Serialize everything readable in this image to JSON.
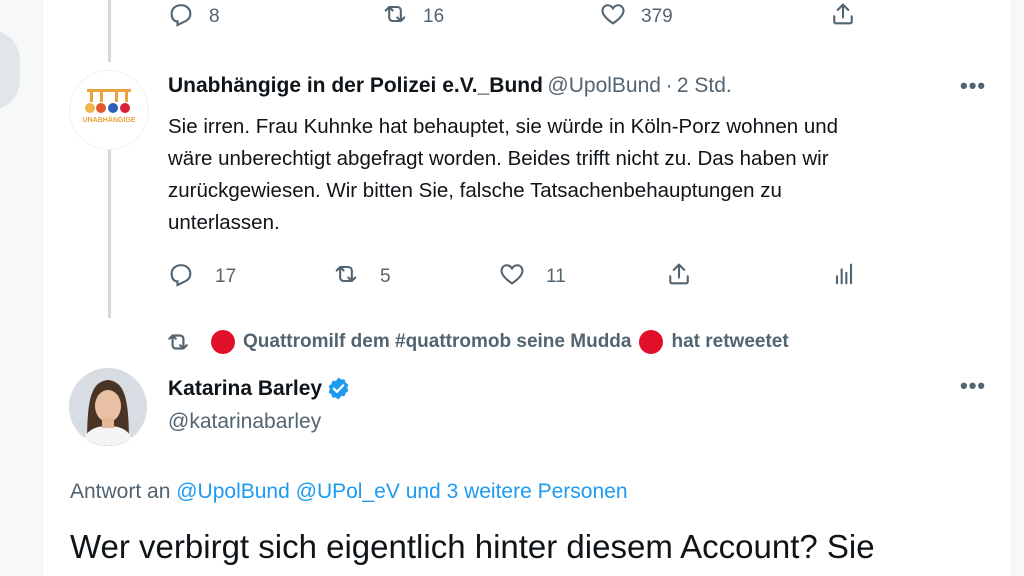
{
  "top_actions": {
    "replies": "8",
    "retweets": "16",
    "likes": "379"
  },
  "tweet1": {
    "display_name": "Unabhängige in der Polizei e.V._Bund",
    "handle": "@UpolBund",
    "separator": "·",
    "time": "2 Std.",
    "avatar_text": "UNABHÄNGIGE",
    "lines": [
      "Sie irren. Frau Kuhnke hat behauptet, sie würde in Köln-Porz wohnen und",
      "wäre unberechtigt abgefragt worden. Beides trifft nicht zu. Das haben wir",
      "zurückgewiesen. Wir bitten Sie, falsche Tatsachenbehauptungen zu",
      "unterlassen."
    ],
    "replies": "17",
    "retweets": "5",
    "likes": "11"
  },
  "retweet_banner": {
    "retweeter": "Quattromilf dem #quattromob seine Mudda",
    "suffix": "hat retweetet"
  },
  "tweet2": {
    "display_name": "Katarina Barley",
    "handle": "@katarinabarley",
    "reply_prefix": "Antwort an",
    "reply_to_1": "@UpolBund",
    "reply_to_2": "@UPol_eV",
    "reply_and": "und",
    "reply_more": "3 weitere Personen",
    "text": "Wer verbirgt sich eigentlich hinter diesem Account? Sie"
  },
  "more_menu_label": "•••",
  "colors": {
    "link": "#1d9bf0",
    "secondary_text": "#536471",
    "verified": "#1d9bf0",
    "red_dot": "#e0102a"
  }
}
